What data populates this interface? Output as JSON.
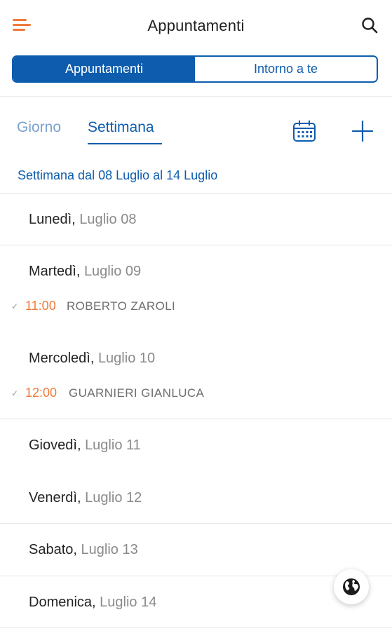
{
  "header": {
    "title": "Appuntamenti",
    "menu_icon": "hamburger-icon",
    "search_icon": "search-icon",
    "accent_color": "#f07a3a"
  },
  "segment": {
    "items": [
      {
        "label": "Appuntamenti",
        "active": true
      },
      {
        "label": "Intorno a te",
        "active": false
      }
    ],
    "color": "#0e5cad"
  },
  "view_tabs": {
    "items": [
      {
        "label": "Giorno",
        "active": false
      },
      {
        "label": "Settimana",
        "active": true
      }
    ],
    "calendar_icon": "calendar-icon",
    "add_icon": "plus-icon"
  },
  "week_range": "Settimana dal 08 Luglio al 14 Luglio",
  "days": [
    {
      "weekday": "Lunedì",
      "date": "Luglio 08",
      "appointments": []
    },
    {
      "weekday": "Martedì",
      "date": "Luglio 09",
      "appointments": [
        {
          "time": "11:00",
          "name": "ROBERTO ZAROLI"
        }
      ]
    },
    {
      "weekday": "Mercoledì",
      "date": "Luglio 10",
      "appointments": [
        {
          "time": "12:00",
          "name": "GUARNIERI GIANLUCA"
        }
      ]
    },
    {
      "weekday": "Giovedì",
      "date": "Luglio 11",
      "appointments": []
    },
    {
      "weekday": "Venerdì",
      "date": "Luglio 12",
      "appointments": []
    },
    {
      "weekday": "Sabato",
      "date": "Luglio 13",
      "appointments": []
    },
    {
      "weekday": "Domenica",
      "date": "Luglio 14",
      "appointments": []
    }
  ],
  "floating_button": {
    "icon": "globe-icon"
  }
}
